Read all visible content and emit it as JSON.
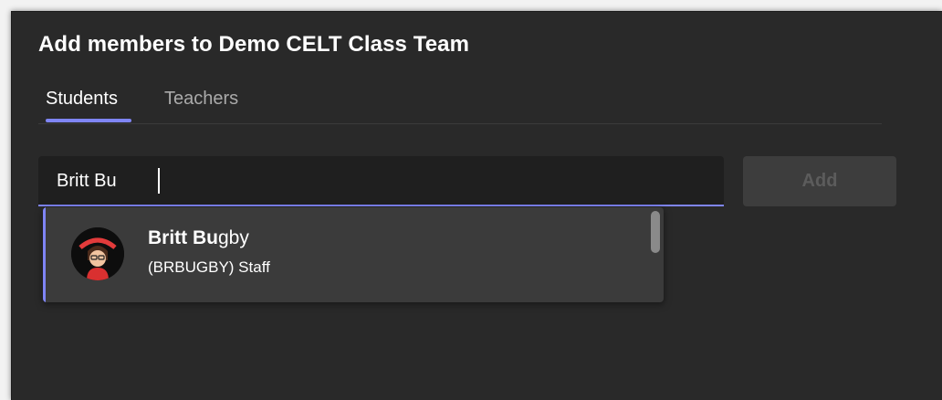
{
  "dialog": {
    "title": "Add members to Demo CELT Class Team"
  },
  "tabs": [
    {
      "label": "Students",
      "selected": true
    },
    {
      "label": "Teachers",
      "selected": false
    }
  ],
  "search": {
    "value": "Britt Bu"
  },
  "add_button": {
    "label": "Add",
    "enabled": false
  },
  "suggestions": [
    {
      "name_match": "Britt Bu",
      "name_rest": "gby",
      "subtitle": "(BRBUGBY) Staff",
      "avatar_icon": "cartoon-avatar-icon"
    }
  ],
  "colors": {
    "accent": "#7f85f5",
    "dialog_bg": "#292929",
    "input_bg": "#1f1f1f",
    "dropdown_bg": "#3b3b3b",
    "disabled_button_bg": "#3d3d3d",
    "disabled_button_text": "#5c5c5c"
  }
}
